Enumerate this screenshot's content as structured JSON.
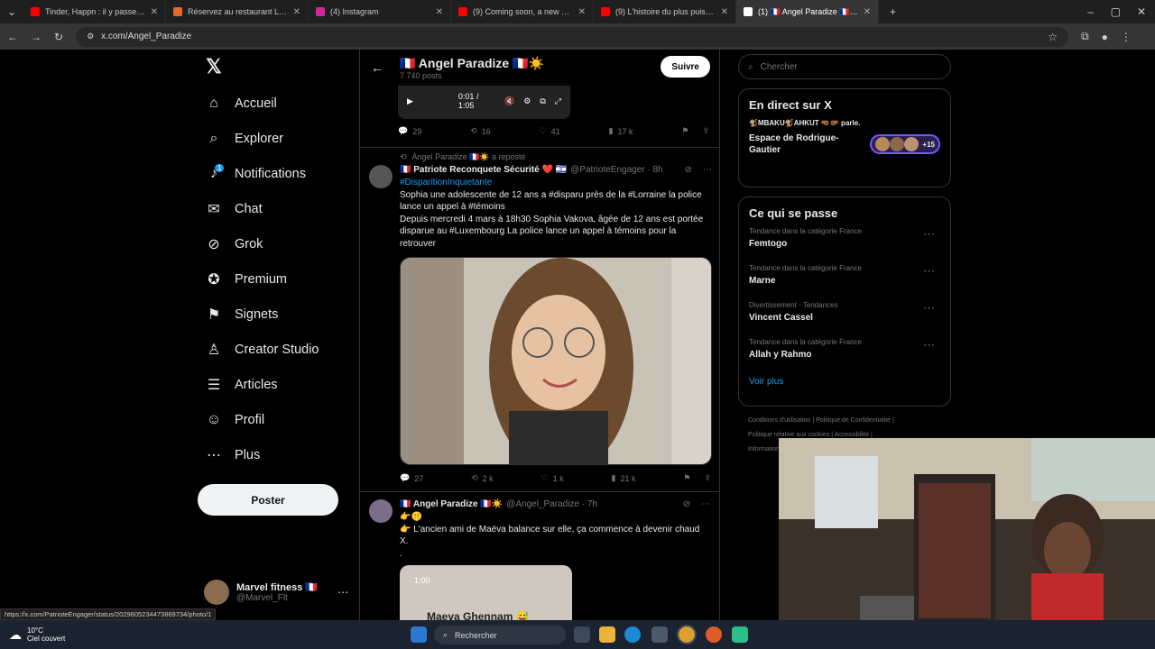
{
  "browser": {
    "tabs": [
      {
        "label": "Tinder, Happn : il y passe 3h p...",
        "color": "#ff0000"
      },
      {
        "label": "Réservez au restaurant Le Jules...",
        "color": "#e06a2a"
      },
      {
        "label": "(4) Instagram",
        "color": "#d6249f"
      },
      {
        "label": "(9) Coming soon, a new RPG fr...",
        "color": "#ff0000"
      },
      {
        "label": "(9) L'histoire du plus puissant c...",
        "color": "#ff0000"
      },
      {
        "label": "(1) 🇫🇷 Angel Paradize 🇫🇷☀️",
        "color": "#ffffff"
      }
    ],
    "url": "x.com/Angel_Paradize"
  },
  "nav": {
    "items": [
      {
        "label": "Accueil",
        "icon": "home-icon",
        "glyph": "⌂"
      },
      {
        "label": "Explorer",
        "icon": "search-icon",
        "glyph": "⌕"
      },
      {
        "label": "Notifications",
        "icon": "bell-icon",
        "glyph": "♪"
      },
      {
        "label": "Chat",
        "icon": "mail-icon",
        "glyph": "✉"
      },
      {
        "label": "Grok",
        "icon": "grok-icon",
        "glyph": "⊘"
      },
      {
        "label": "Premium",
        "icon": "premium-icon",
        "glyph": "✪"
      },
      {
        "label": "Signets",
        "icon": "bookmark-icon",
        "glyph": "⚑"
      },
      {
        "label": "Creator Studio",
        "icon": "creator-icon",
        "glyph": "♙"
      },
      {
        "label": "Articles",
        "icon": "article-icon",
        "glyph": "☰"
      },
      {
        "label": "Profil",
        "icon": "profile-icon",
        "glyph": "☺"
      },
      {
        "label": "Plus",
        "icon": "more-icon",
        "glyph": "⋯"
      }
    ],
    "post_label": "Poster",
    "account_name": "Marvel fitness 🇫🇷",
    "account_handle": "@Marvel_Flt",
    "notif_badge": "1"
  },
  "profile_header": {
    "title": "🇫🇷 Angel Paradize 🇫🇷☀️",
    "posts": "7 740 posts",
    "follow_label": "Suivre"
  },
  "video": {
    "time": "0:01 / 1:05"
  },
  "tweet0": {
    "replies": "29",
    "reposts": "16",
    "likes": "41",
    "views": "17 k"
  },
  "tweet1": {
    "repost_by": "Angel Paradize 🇫🇷☀️ a reposté",
    "name": "🇫🇷 Patriote Reconquete Sécurité ❤️ 🇮🇱",
    "handle": "@PatrioteEngager · 8h",
    "line1": "#DisparitionInquietante",
    "line2": "Sophia une adolescente de 12 ans a #disparu près de la #Lorraine la police lance un appel à #témoins",
    "line3": "Depuis mercredi 4 mars à 18h30 Sophia Vakova, âgée de 12 ans est portée disparue au #Luxembourg La police lance un appel à témoins pour la retrouver",
    "replies": "27",
    "reposts": "2 k",
    "likes": "1 k",
    "views": "21 k"
  },
  "tweet2": {
    "name": "🇫🇷 Angel Paradize 🇫🇷☀️",
    "handle": "@Angel_Paradize · 7h",
    "emoji_line": "👉🤫",
    "text": "👉 L'ancien ami de Maëva balance sur elle, ça commence à devenir chaud X.",
    "dot": ".",
    "video_time": "1:00",
    "video_caption": "Maeva Ghennam 😅"
  },
  "sidebar": {
    "search_placeholder": "Chercher",
    "live_title": "En direct sur X",
    "live_speakers": "🐒MBAKU🐒AHKUT 🤜🏾🤛🏾 parle.",
    "live_space": "Espace de Rodrigue-Gautier",
    "live_count": "+15",
    "trends_title": "Ce qui se passe",
    "trends": [
      {
        "category": "Tendance dans la catégorie France",
        "name": "Femtogo"
      },
      {
        "category": "Tendance dans la catégorie France",
        "name": "Marne"
      },
      {
        "category": "Divertissement · Tendances",
        "name": "Vincent Cassel"
      },
      {
        "category": "Tendance dans la catégorie France",
        "name": "Allah y Rahmo"
      }
    ],
    "see_more": "Voir plus",
    "footer1": "Conditions d'utilisation  |  Politique de Confidentialité  |",
    "footer2": "Politique relative aux cookies  |  Accessibilité  |",
    "footer3": "Informations"
  },
  "status_url": "https://x.com/PatrioteEngager/status/2029605234473869734/photo/1",
  "taskbar": {
    "temp": "10°C",
    "weather": "Ciel couvert",
    "search": "Rechercher"
  },
  "colors": {
    "accent": "#1d9bf0",
    "background": "#000000"
  }
}
